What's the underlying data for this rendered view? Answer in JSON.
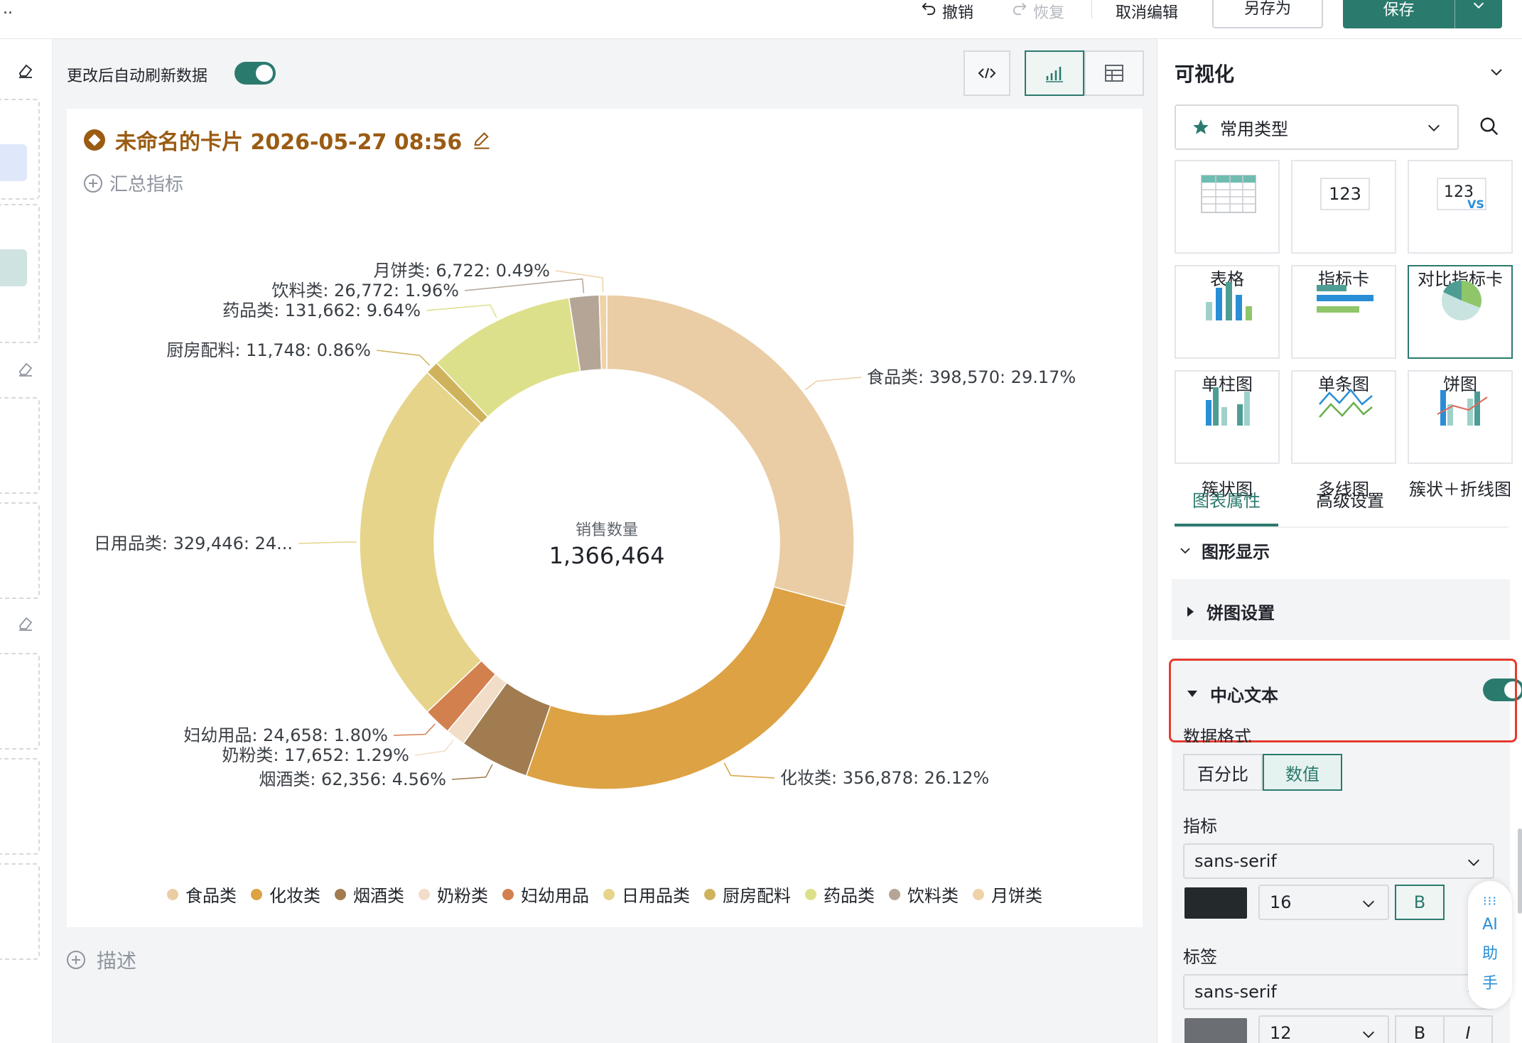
{
  "topbar": {
    "undo": "撤销",
    "redo": "恢复",
    "cancel_edit": "取消编辑",
    "save_as": "另存为",
    "save": "保存"
  },
  "main": {
    "auto_refresh_label": "更改后自动刷新数据",
    "auto_refresh_on": true,
    "card_title": "未命名的卡片 2026-05-27 08:56",
    "add_metric": "汇总指标",
    "add_description": "描述"
  },
  "chart_data": {
    "type": "pie",
    "variant": "donut",
    "center_label": "销售数量",
    "center_value": "1,366,464",
    "slices": [
      {
        "name": "食品类",
        "value": 398570,
        "percent": 29.17,
        "label": "食品类: 398,570: 29.17%",
        "color": "#eacda5"
      },
      {
        "name": "化妆类",
        "value": 356878,
        "percent": 26.12,
        "label": "化妆类: 356,878: 26.12%",
        "color": "#dda244"
      },
      {
        "name": "烟酒类",
        "value": 62356,
        "percent": 4.56,
        "label": "烟酒类: 62,356: 4.56%",
        "color": "#a07c50"
      },
      {
        "name": "奶粉类",
        "value": 17652,
        "percent": 1.29,
        "label": "奶粉类: 17,652: 1.29%",
        "color": "#f2ddc8"
      },
      {
        "name": "妇幼用品",
        "value": 24658,
        "percent": 1.8,
        "label": "妇幼用品: 24,658: 1.80%",
        "color": "#d3804f"
      },
      {
        "name": "日用品类",
        "value": 329446,
        "percent": 24.11,
        "label": "日用品类: 329,446: 24...",
        "color": "#e6d48a"
      },
      {
        "name": "厨房配料",
        "value": 11748,
        "percent": 0.86,
        "label": "厨房配料: 11,748: 0.86%",
        "color": "#cfb35c"
      },
      {
        "name": "药品类",
        "value": 131662,
        "percent": 9.64,
        "label": "药品类: 131,662: 9.64%",
        "color": "#dde08a"
      },
      {
        "name": "饮料类",
        "value": 26772,
        "percent": 1.96,
        "label": "饮料类: 26,772: 1.96%",
        "color": "#b5a597"
      },
      {
        "name": "月饼类",
        "value": 6722,
        "percent": 0.49,
        "label": "月饼类: 6,722: 0.49%",
        "color": "#efd3a6"
      }
    ],
    "legend_position": "bottom"
  },
  "panel": {
    "title": "可视化",
    "type_select": "常用类型",
    "tiles": [
      {
        "label": "表格",
        "icon": "table-icon"
      },
      {
        "label": "指标卡",
        "icon": "metric-card-icon",
        "text": "123"
      },
      {
        "label": "对比指标卡",
        "icon": "compare-metric-icon",
        "text": "123",
        "sub": "VS"
      },
      {
        "label": "单柱图",
        "icon": "bar-chart-icon"
      },
      {
        "label": "单条图",
        "icon": "horizontal-bar-icon"
      },
      {
        "label": "饼图",
        "icon": "pie-chart-icon",
        "active": true
      },
      {
        "label": "簇状图",
        "icon": "grouped-bar-icon"
      },
      {
        "label": "多线图",
        "icon": "multi-line-icon"
      },
      {
        "label": "簇状＋折线图",
        "icon": "combo-chart-icon"
      }
    ],
    "tab_props": "图表属性",
    "tab_advanced": "高级设置",
    "section_display": "图形显示",
    "section_pie": "饼图设置",
    "section_center": "中心文本",
    "center_text_on": true,
    "data_format_label": "数据格式",
    "format_percent": "百分比",
    "format_value": "数值",
    "metric_label": "指标",
    "metric_font": "sans-serif",
    "metric_size": "16",
    "metric_color": "#24292b",
    "bold": "B",
    "label_label": "标签",
    "label_font": "sans-serif",
    "label_size": "12",
    "label_color": "#6b6e72",
    "italic": "I",
    "ai_helper": [
      "AI",
      "助",
      "手"
    ]
  }
}
